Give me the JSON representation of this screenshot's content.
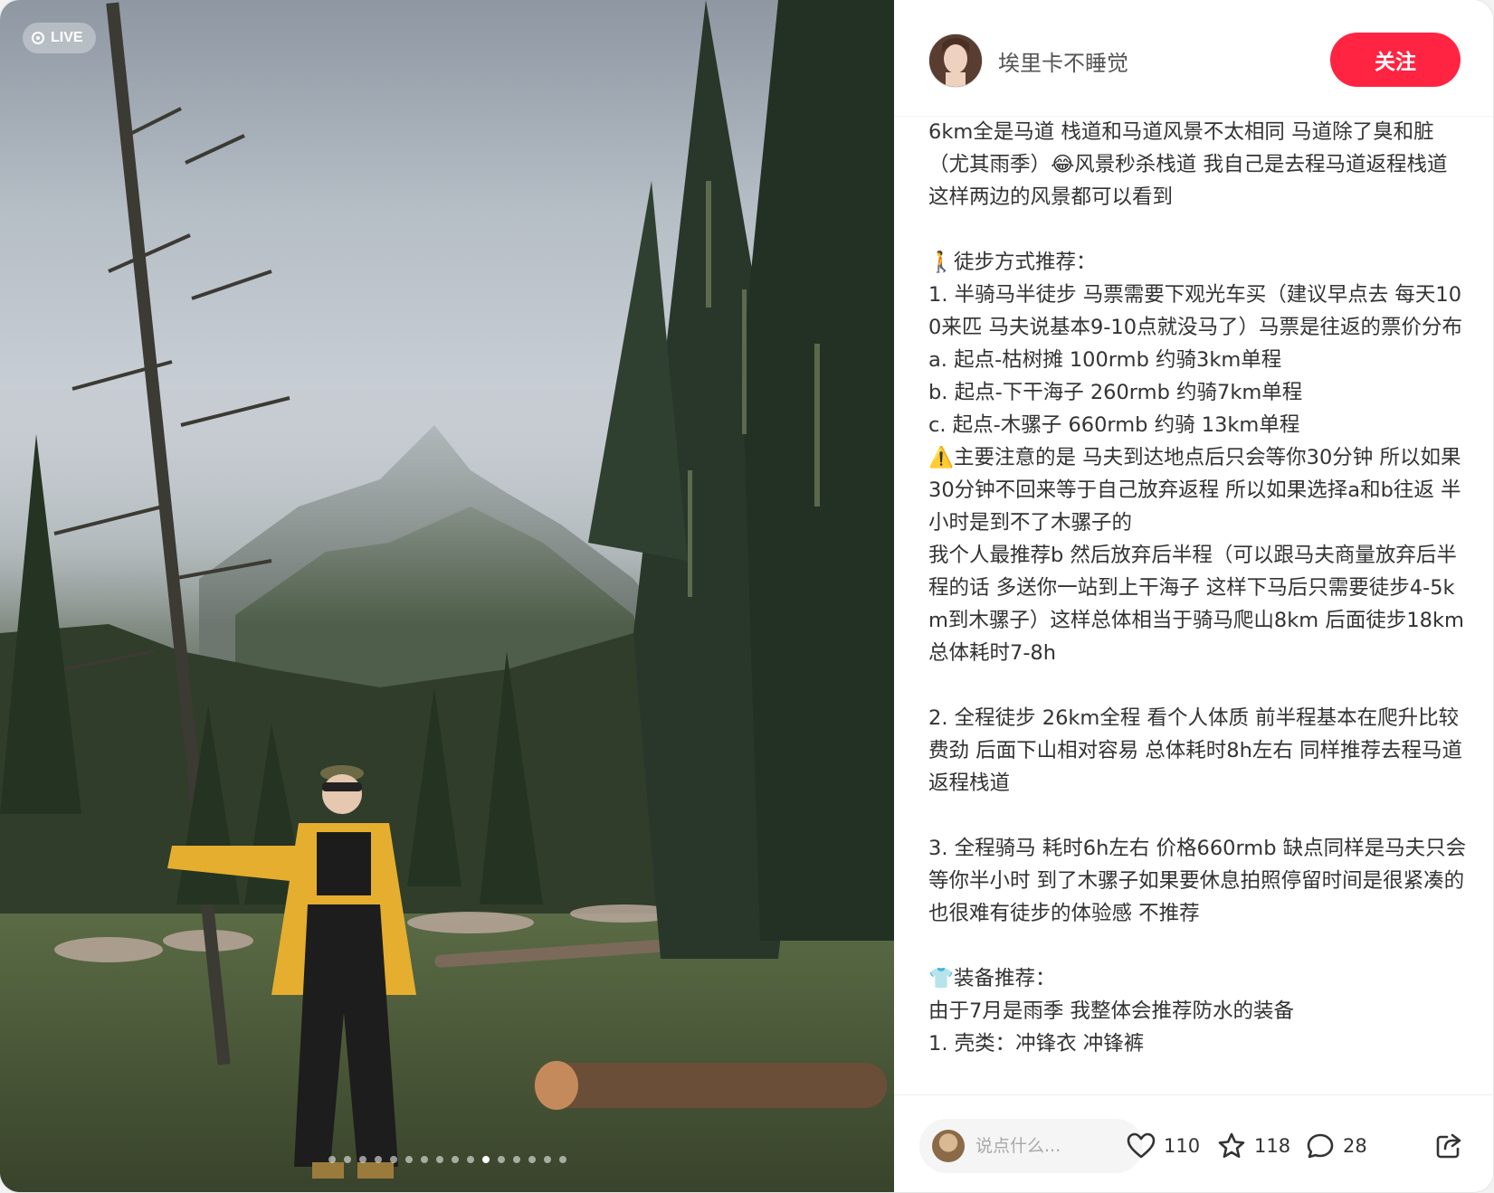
{
  "photo": {
    "live_label": "LIVE",
    "dot_count": 16,
    "active_dot_index": 10
  },
  "author": {
    "name": "埃里卡不睡觉",
    "follow_label": "关注"
  },
  "post": {
    "lines": [
      "6km全是马道 栈道和马道风景不太相同 马道除了臭和脏（尤其雨季）😂风景秒杀栈道 我自己是去程马道返程栈道 这样两边的风景都可以看到",
      "",
      "🚶徒步方式推荐：",
      "1. 半骑马半徒步 马票需要下观光车买（建议早点去 每天100来匹 马夫说基本9-10点就没马了）马票是往返的票价分布",
      "a. 起点-枯树摊 100rmb 约骑3km单程",
      "b. 起点-下干海子 260rmb 约骑7km单程",
      "c. 起点-木骡子 660rmb 约骑 13km单程",
      "⚠️主要注意的是 马夫到达地点后只会等你30分钟 所以如果30分钟不回来等于自己放弃返程 所以如果选择a和b往返 半小时是到不了木骡子的",
      "我个人最推荐b 然后放弃后半程（可以跟马夫商量放弃后半程的话 多送你一站到上干海子 这样下马后只需要徒步4-5km到木骡子）这样总体相当于骑马爬山8km 后面徒步18km 总体耗时7-8h",
      "",
      "2. 全程徒步 26km全程 看个人体质 前半程基本在爬升比较费劲 后面下山相对容易 总体耗时8h左右 同样推荐去程马道返程栈道",
      "",
      "3. 全程骑马 耗时6h左右 价格660rmb 缺点同样是马夫只会等你半小时 到了木骡子如果要休息拍照停留时间是很紧凑的 也很难有徒步的体验感 不推荐",
      "",
      "👕装备推荐：",
      "由于7月是雨季 我整体会推荐防水的装备",
      "1. 壳类：冲锋衣 冲锋裤"
    ]
  },
  "bottom": {
    "comment_placeholder": "说点什么...",
    "likes": "110",
    "collects": "118",
    "comments": "28"
  },
  "colors": {
    "follow_button": "#ff2442",
    "text": "#333333",
    "author_name": "#555555"
  },
  "icons": [
    "live-icon",
    "heart-icon",
    "star-icon",
    "comment-icon",
    "share-icon"
  ]
}
